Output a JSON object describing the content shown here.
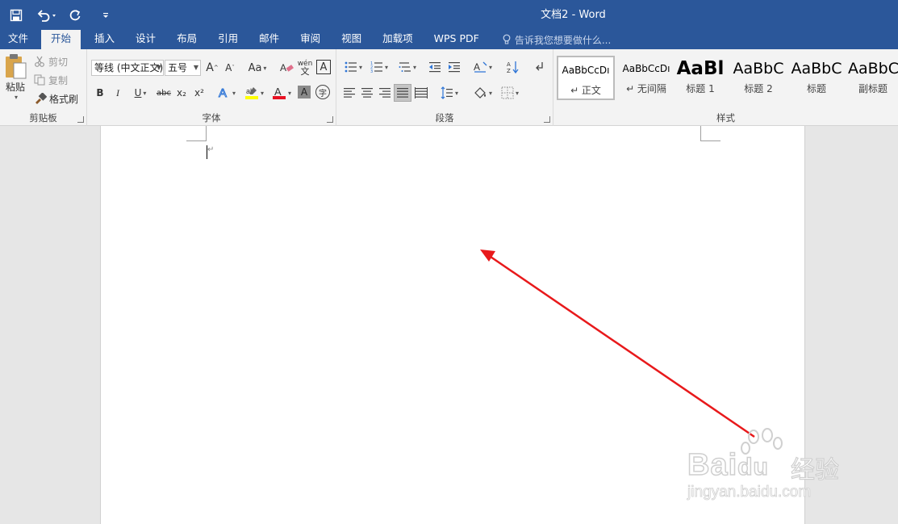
{
  "window": {
    "title": "文档2 - Word"
  },
  "qat": {
    "save_icon": "save-icon",
    "undo_icon": "undo-icon",
    "redo_icon": "redo-icon",
    "customize_icon": "customize-qat-icon"
  },
  "tabs": [
    {
      "label": "文件"
    },
    {
      "label": "开始"
    },
    {
      "label": "插入"
    },
    {
      "label": "设计"
    },
    {
      "label": "布局"
    },
    {
      "label": "引用"
    },
    {
      "label": "邮件"
    },
    {
      "label": "审阅"
    },
    {
      "label": "视图"
    },
    {
      "label": "加载项"
    },
    {
      "label": "WPS PDF"
    }
  ],
  "tell_me": {
    "placeholder": "告诉我您想要做什么..."
  },
  "clipboard": {
    "paste": "粘贴",
    "cut": "剪切",
    "copy": "复制",
    "format_painter": "格式刷",
    "group_label": "剪贴板"
  },
  "font": {
    "name": "等线 (中文正文)",
    "size": "五号",
    "case_label": "Aa",
    "group_label": "字体",
    "bold": "B",
    "italic": "I",
    "underline": "U",
    "strike": "abc",
    "sub": "x₂",
    "sup": "x²",
    "grow": "A",
    "shrink": "A",
    "phonetic_top": "wén",
    "phonetic_bottom": "文",
    "border_char": "A",
    "shade_char": "A",
    "enclose_char": "字"
  },
  "paragraph": {
    "group_label": "段落"
  },
  "styles": {
    "group_label": "样式",
    "items": [
      {
        "preview": "AaBbCcDı",
        "name": "↵ 正文"
      },
      {
        "preview": "AaBbCcDı",
        "name": "↵ 无间隔"
      },
      {
        "preview": "AaBl",
        "name": "标题 1"
      },
      {
        "preview": "AaBbC",
        "name": "标题 2"
      },
      {
        "preview": "AaBbC",
        "name": "标题"
      },
      {
        "preview": "AaBbC",
        "name": "副标题"
      }
    ]
  },
  "document": {
    "paragraph_mark": "↵"
  },
  "annotation": {
    "arrow_color": "#e8191b"
  },
  "watermark": {
    "brand": "Bai",
    "brand2": "du",
    "suffix": "经验",
    "url": "jingyan.baidu.com"
  },
  "colors": {
    "accent": "#2b579a",
    "ribbon": "#f3f3f3",
    "highlight": "#ffff00",
    "font_color": "#e81123"
  }
}
